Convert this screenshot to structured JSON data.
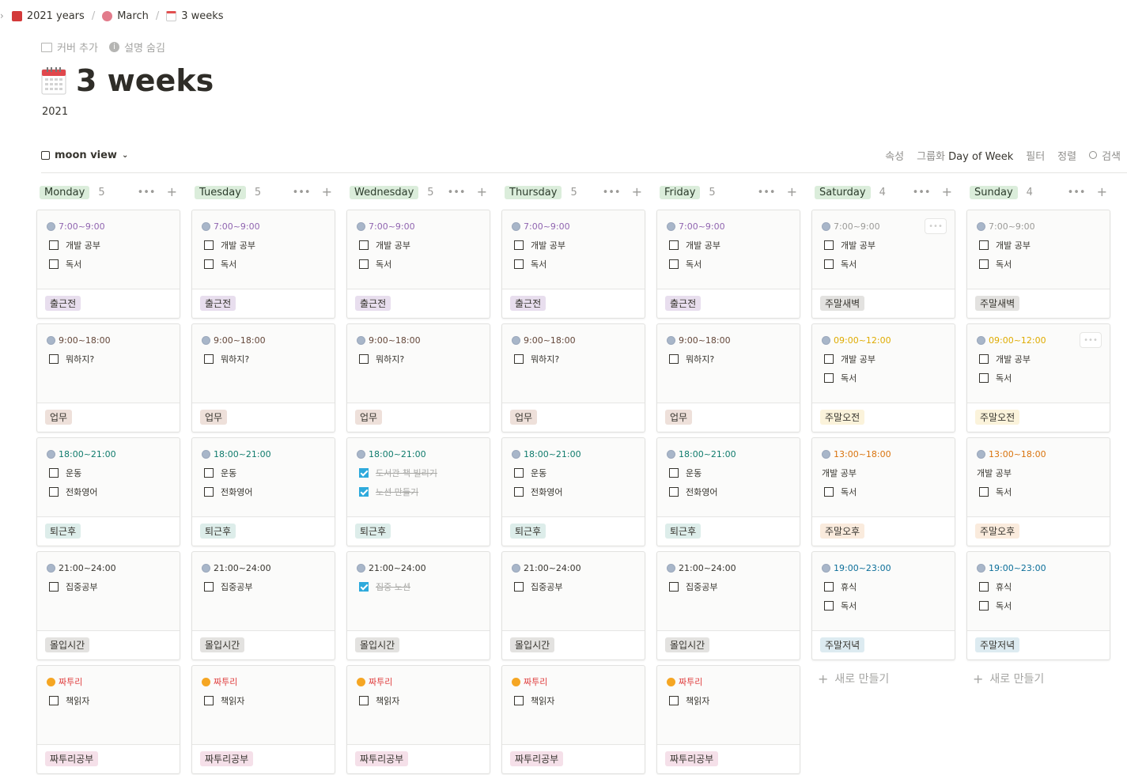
{
  "breadcrumb": [
    {
      "label": "2021 years",
      "icon": "book-icon",
      "color": "#d33a3a"
    },
    {
      "label": "March",
      "icon": "flower-icon",
      "color": "#e27b8b"
    },
    {
      "label": "3 weeks",
      "icon": "calendar-icon",
      "color": "#c9c9c9"
    }
  ],
  "actions": {
    "add_cover": "커버 추가",
    "hide_desc": "설명 숨김"
  },
  "page": {
    "title": "3 weeks",
    "description": "2021"
  },
  "view": {
    "name": "moon view",
    "tools": {
      "properties": "속성",
      "group_prefix": "그룹화",
      "group_value": "Day of Week",
      "filter": "필터",
      "sort": "정렬",
      "search": "검색"
    }
  },
  "colors": {
    "morning": "#e8deee",
    "work": "#eee0da",
    "evening": "#ddedea",
    "focus": "#e3e2e0",
    "free": "#f5e0e9",
    "weekend_dawn": "#e3e2e0",
    "weekend_am": "#fbf3db",
    "weekend_pm": "#faebdd",
    "weekend_eve": "#ddebf1"
  },
  "columns": [
    {
      "day": "Monday",
      "count": "5",
      "cards": [
        {
          "time": "7:00~9:00",
          "tc": "#9065b0",
          "todos": [
            {
              "t": "개발 공부"
            },
            {
              "t": "독서"
            }
          ],
          "tag": "출근전",
          "tagc": "morning"
        },
        {
          "time": "9:00~18:00",
          "tc": "#64473a",
          "todos": [
            {
              "t": "뭐하지?"
            }
          ],
          "tag": "업무",
          "tagc": "work"
        },
        {
          "time": "18:00~21:00",
          "tc": "#0f7b6c",
          "todos": [
            {
              "t": "운동"
            },
            {
              "t": "전화영어"
            }
          ],
          "tag": "퇴근후",
          "tagc": "evening"
        },
        {
          "time": "21:00~24:00",
          "tc": "#37352f",
          "todos": [
            {
              "t": "집중공부"
            }
          ],
          "tag": "몰입시간",
          "tagc": "focus"
        },
        {
          "time": "짜투리",
          "tc": "#e03e3e",
          "heart": true,
          "todos": [
            {
              "t": "책읽자"
            }
          ],
          "tag": "짜투리공부",
          "tagc": "free"
        }
      ]
    },
    {
      "day": "Tuesday",
      "count": "5",
      "cards": [
        {
          "time": "7:00~9:00",
          "tc": "#9065b0",
          "todos": [
            {
              "t": "개발 공부"
            },
            {
              "t": "독서"
            }
          ],
          "tag": "출근전",
          "tagc": "morning"
        },
        {
          "time": "9:00~18:00",
          "tc": "#64473a",
          "todos": [
            {
              "t": "뭐하지?"
            }
          ],
          "tag": "업무",
          "tagc": "work"
        },
        {
          "time": "18:00~21:00",
          "tc": "#0f7b6c",
          "todos": [
            {
              "t": "운동"
            },
            {
              "t": "전화영어"
            }
          ],
          "tag": "퇴근후",
          "tagc": "evening"
        },
        {
          "time": "21:00~24:00",
          "tc": "#37352f",
          "todos": [
            {
              "t": "집중공부"
            }
          ],
          "tag": "몰입시간",
          "tagc": "focus"
        },
        {
          "time": "짜투리",
          "tc": "#e03e3e",
          "heart": true,
          "todos": [
            {
              "t": "책읽자"
            }
          ],
          "tag": "짜투리공부",
          "tagc": "free"
        }
      ]
    },
    {
      "day": "Wednesday",
      "count": "5",
      "cards": [
        {
          "time": "7:00~9:00",
          "tc": "#9065b0",
          "todos": [
            {
              "t": "개발 공부"
            },
            {
              "t": "독서"
            }
          ],
          "tag": "출근전",
          "tagc": "morning"
        },
        {
          "time": "9:00~18:00",
          "tc": "#64473a",
          "todos": [
            {
              "t": "뭐하지?"
            }
          ],
          "tag": "업무",
          "tagc": "work"
        },
        {
          "time": "18:00~21:00",
          "tc": "#0f7b6c",
          "todos": [
            {
              "t": "도서관 책 빌리기",
              "done": true
            },
            {
              "t": "노션 만들기",
              "done": true
            }
          ],
          "tag": "퇴근후",
          "tagc": "evening"
        },
        {
          "time": "21:00~24:00",
          "tc": "#37352f",
          "todos": [
            {
              "t": "집중 노션",
              "done": true
            }
          ],
          "tag": "몰입시간",
          "tagc": "focus"
        },
        {
          "time": "짜투리",
          "tc": "#e03e3e",
          "heart": true,
          "todos": [
            {
              "t": "책읽자"
            }
          ],
          "tag": "짜투리공부",
          "tagc": "free"
        }
      ]
    },
    {
      "day": "Thursday",
      "count": "5",
      "cards": [
        {
          "time": "7:00~9:00",
          "tc": "#9065b0",
          "todos": [
            {
              "t": "개발 공부"
            },
            {
              "t": "독서"
            }
          ],
          "tag": "출근전",
          "tagc": "morning"
        },
        {
          "time": "9:00~18:00",
          "tc": "#64473a",
          "todos": [
            {
              "t": "뭐하지?"
            }
          ],
          "tag": "업무",
          "tagc": "work"
        },
        {
          "time": "18:00~21:00",
          "tc": "#0f7b6c",
          "todos": [
            {
              "t": "운동"
            },
            {
              "t": "전화영어"
            }
          ],
          "tag": "퇴근후",
          "tagc": "evening"
        },
        {
          "time": "21:00~24:00",
          "tc": "#37352f",
          "todos": [
            {
              "t": "집중공부"
            }
          ],
          "tag": "몰입시간",
          "tagc": "focus"
        },
        {
          "time": "짜투리",
          "tc": "#e03e3e",
          "heart": true,
          "todos": [
            {
              "t": "책읽자"
            }
          ],
          "tag": "짜투리공부",
          "tagc": "free"
        }
      ]
    },
    {
      "day": "Friday",
      "count": "5",
      "cards": [
        {
          "time": "7:00~9:00",
          "tc": "#9065b0",
          "todos": [
            {
              "t": "개발 공부"
            },
            {
              "t": "독서"
            }
          ],
          "tag": "출근전",
          "tagc": "morning"
        },
        {
          "time": "9:00~18:00",
          "tc": "#64473a",
          "todos": [
            {
              "t": "뭐하지?"
            }
          ],
          "tag": "업무",
          "tagc": "work"
        },
        {
          "time": "18:00~21:00",
          "tc": "#0f7b6c",
          "todos": [
            {
              "t": "운동"
            },
            {
              "t": "전화영어"
            }
          ],
          "tag": "퇴근후",
          "tagc": "evening"
        },
        {
          "time": "21:00~24:00",
          "tc": "#37352f",
          "todos": [
            {
              "t": "집중공부"
            }
          ],
          "tag": "몰입시간",
          "tagc": "focus"
        },
        {
          "time": "짜투리",
          "tc": "#e03e3e",
          "heart": true,
          "todos": [
            {
              "t": "책읽자"
            }
          ],
          "tag": "짜투리공부",
          "tagc": "free"
        }
      ]
    },
    {
      "day": "Saturday",
      "count": "4",
      "new": "새로 만들기",
      "cards": [
        {
          "time": "7:00~9:00",
          "tc": "#9b9a97",
          "todos": [
            {
              "t": "개발 공부"
            },
            {
              "t": "독서"
            }
          ],
          "tag": "주말새벽",
          "tagc": "weekend_dawn",
          "dots": true
        },
        {
          "time": "09:00~12:00",
          "tc": "#dfab01",
          "todos": [
            {
              "t": "개발 공부"
            },
            {
              "t": "독서"
            }
          ],
          "tag": "주말오전",
          "tagc": "weekend_am"
        },
        {
          "time": "13:00~18:00",
          "tc": "#d9730d",
          "plain": "개발 공부",
          "todos": [
            {
              "t": "독서"
            }
          ],
          "tag": "주말오후",
          "tagc": "weekend_pm"
        },
        {
          "time": "19:00~23:00",
          "tc": "#0b6e99",
          "todos": [
            {
              "t": "휴식"
            },
            {
              "t": "독서"
            }
          ],
          "tag": "주말저녁",
          "tagc": "weekend_eve"
        }
      ]
    },
    {
      "day": "Sunday",
      "count": "4",
      "new": "새로 만들기",
      "cards": [
        {
          "time": "7:00~9:00",
          "tc": "#9b9a97",
          "todos": [
            {
              "t": "개발 공부"
            },
            {
              "t": "독서"
            }
          ],
          "tag": "주말새벽",
          "tagc": "weekend_dawn"
        },
        {
          "time": "09:00~12:00",
          "tc": "#dfab01",
          "todos": [
            {
              "t": "개발 공부"
            },
            {
              "t": "독서"
            }
          ],
          "tag": "주말오전",
          "tagc": "weekend_am",
          "dots": true
        },
        {
          "time": "13:00~18:00",
          "tc": "#d9730d",
          "plain": "개발 공부",
          "todos": [
            {
              "t": "독서"
            }
          ],
          "tag": "주말오후",
          "tagc": "weekend_pm"
        },
        {
          "time": "19:00~23:00",
          "tc": "#0b6e99",
          "todos": [
            {
              "t": "휴식"
            },
            {
              "t": "독서"
            }
          ],
          "tag": "주말저녁",
          "tagc": "weekend_eve"
        }
      ]
    }
  ]
}
